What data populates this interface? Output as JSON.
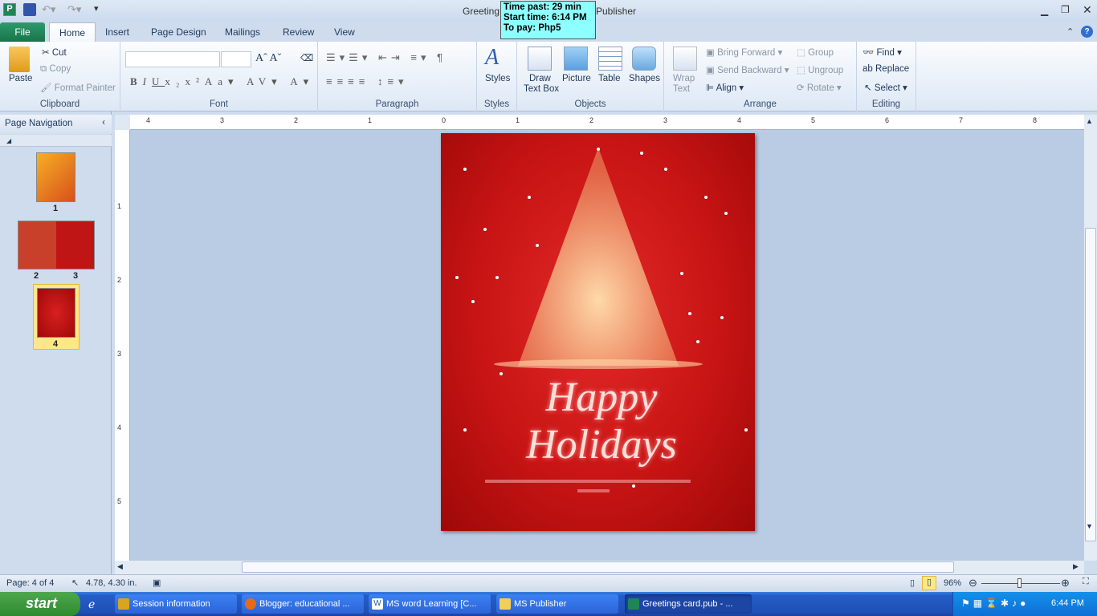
{
  "window": {
    "title_left": "Greeting",
    "title_right": "Publisher",
    "minimize_icon": "minimize-icon",
    "restore_icon": "restore-icon",
    "close_icon": "close-icon"
  },
  "timer": {
    "time_past": "Time past: 29 min",
    "start_time": "Start time: 6:14 PM",
    "to_pay": "To pay: Php5"
  },
  "tabs": [
    {
      "label": "File"
    },
    {
      "label": "Home"
    },
    {
      "label": "Insert"
    },
    {
      "label": "Page Design"
    },
    {
      "label": "Mailings"
    },
    {
      "label": "Review"
    },
    {
      "label": "View"
    }
  ],
  "ribbon": {
    "clipboard": {
      "label": "Clipboard",
      "paste": "Paste",
      "cut": "Cut",
      "copy": "Copy",
      "format_painter": "Format Painter"
    },
    "font": {
      "label": "Font",
      "font_name": "",
      "font_size": ""
    },
    "paragraph": {
      "label": "Paragraph"
    },
    "styles": {
      "label": "Styles",
      "styles": "Styles"
    },
    "objects": {
      "label": "Objects",
      "draw_text_box_1": "Draw",
      "draw_text_box_2": "Text Box",
      "picture": "Picture",
      "table": "Table",
      "shapes": "Shapes"
    },
    "arrange": {
      "label": "Arrange",
      "wrap_text_1": "Wrap",
      "wrap_text_2": "Text",
      "bring_forward": "Bring Forward",
      "send_backward": "Send Backward",
      "align": "Align",
      "group": "Group",
      "ungroup": "Ungroup",
      "rotate": "Rotate"
    },
    "editing": {
      "label": "Editing",
      "find": "Find",
      "replace": "Replace",
      "select": "Select"
    }
  },
  "nav": {
    "title": "Page Navigation",
    "pages": [
      "1",
      "2",
      "3",
      "4"
    ],
    "selected_page": "4"
  },
  "ruler": {
    "h_ticks": [
      "4",
      "3",
      "2",
      "1",
      "0",
      "1",
      "2",
      "3",
      "4",
      "5",
      "6",
      "7",
      "8"
    ],
    "v_ticks": [
      "1",
      "2",
      "3",
      "4",
      "5"
    ]
  },
  "card": {
    "greeting": "Happy Holidays"
  },
  "status": {
    "page": "Page: 4 of 4",
    "position": "4.78, 4.30 in.",
    "zoom": "96%",
    "zoom_fraction": 0.48
  },
  "taskbar": {
    "start": "start",
    "items": [
      {
        "label": "Session information"
      },
      {
        "label": "Blogger: educational ..."
      },
      {
        "label": "MS word Learning [C..."
      },
      {
        "label": "MS Publisher"
      },
      {
        "label": "Greetings card.pub - ..."
      }
    ],
    "clock": "6:44 PM"
  },
  "colors": {
    "file_tab": "#1f8557",
    "card_red": "#c81414",
    "timer_bg": "#8effff",
    "taskbar": "#245dc8"
  }
}
